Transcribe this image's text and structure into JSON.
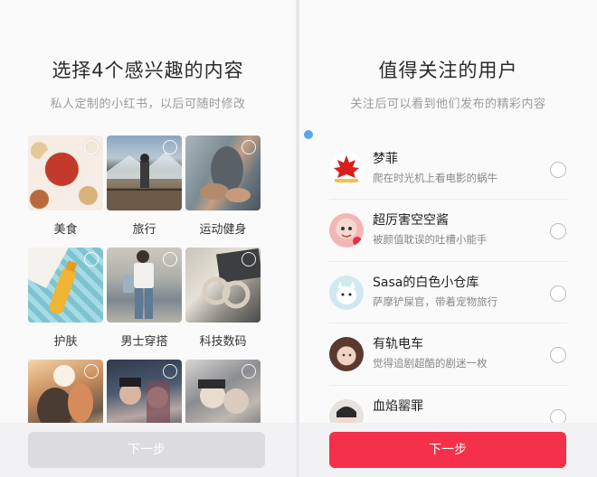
{
  "left": {
    "title": "选择4个感兴趣的内容",
    "subtitle": "私人定制的小红书，以后可随时修改",
    "interests": [
      {
        "label": "美食",
        "icon": "food-photo"
      },
      {
        "label": "旅行",
        "icon": "travel-photo"
      },
      {
        "label": "运动健身",
        "icon": "fitness-photo"
      },
      {
        "label": "护肤",
        "icon": "skincare-photo"
      },
      {
        "label": "男士穿搭",
        "icon": "menswear-photo"
      },
      {
        "label": "科技数码",
        "icon": "tech-photo"
      },
      {
        "label": "",
        "icon": "anime-photo"
      },
      {
        "label": "",
        "icon": "celebrity-photo"
      },
      {
        "label": "",
        "icon": "drama-photo"
      }
    ],
    "next_label": "下一步",
    "next_state": "disabled"
  },
  "right": {
    "title": "值得关注的用户",
    "subtitle": "关注后可以看到他们发布的精彩内容",
    "users": [
      {
        "name": "梦菲",
        "desc": "爬在时光机上看电影的蜗牛"
      },
      {
        "name": "超厉害空空酱",
        "desc": "被颜值耽误的吐槽小能手"
      },
      {
        "name": "Sasa的白色小仓库",
        "desc": "萨摩铲屎官，带着宠物旅行"
      },
      {
        "name": "有轨电车",
        "desc": "觉得追剧超酷的剧迷一枚"
      },
      {
        "name": "血焰罂罪",
        "desc": ""
      }
    ],
    "next_label": "下一步",
    "accent_color": "#f5304a"
  }
}
